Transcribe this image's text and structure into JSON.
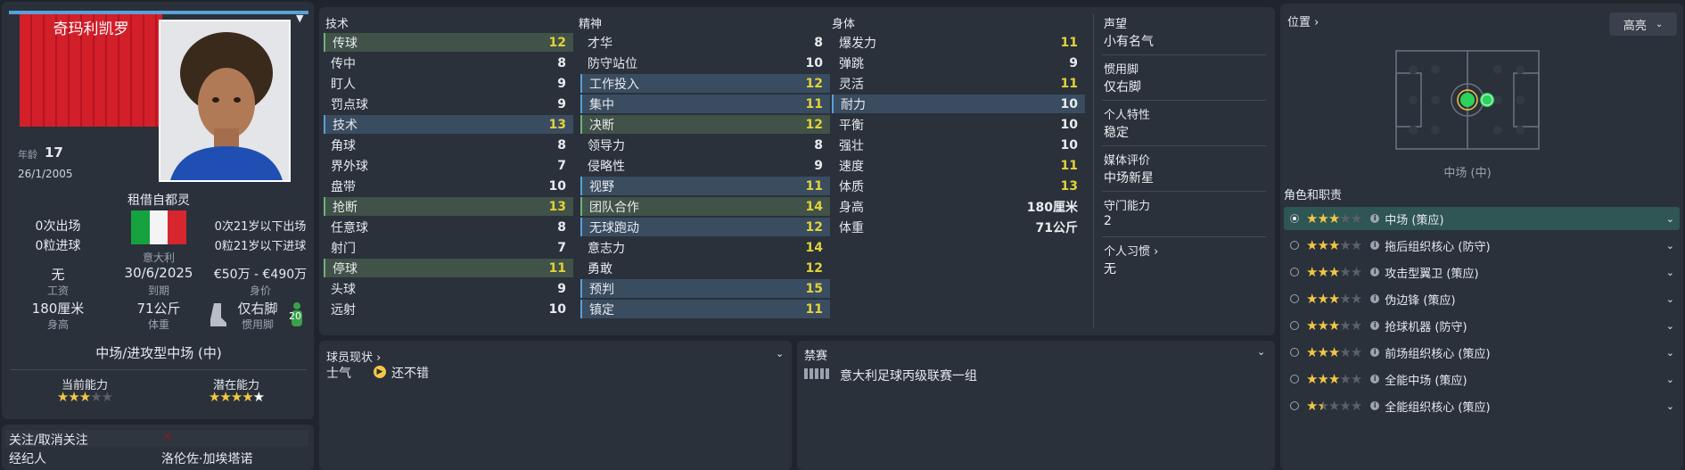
{
  "player": {
    "name": "奇玛利凯罗",
    "age_label": "年龄",
    "age": "17",
    "dob": "26/1/2005",
    "loan_text": "租借自都灵",
    "apps": "0次出场",
    "goals": "0粒进球",
    "u21_apps": "0次21岁以下出场",
    "u21_goals": "0粒21岁以下进球",
    "nation": "意大利",
    "wage_value": "无",
    "wage_label": "工资",
    "expiry_value": "30/6/2025",
    "expiry_label": "到期",
    "value_value": "€50万 - €490万",
    "value_label": "身价",
    "height_value": "180厘米",
    "height_label": "身高",
    "weight_value": "71公斤",
    "weight_label": "体重",
    "foot_value": "仅右脚",
    "foot_label": "惯用脚",
    "foot_badge": "20",
    "position": "中场/进攻型中场 (中)",
    "ca_label": "当前能力",
    "pa_label": "潜在能力",
    "ca_stars": 3,
    "pa_stars": 4.5,
    "follow_label": "关注/取消关注",
    "agent_label": "经纪人",
    "agent_value": "洛伦佐·加埃塔诺"
  },
  "attributes": {
    "technical_title": "技术",
    "mental_title": "精神",
    "physical_title": "身体",
    "technical": [
      {
        "name": "传球",
        "value": "12",
        "hl": "g",
        "y": true
      },
      {
        "name": "传中",
        "value": "8",
        "hl": "",
        "y": false
      },
      {
        "name": "盯人",
        "value": "9",
        "hl": "",
        "y": false
      },
      {
        "name": "罚点球",
        "value": "9",
        "hl": "",
        "y": false
      },
      {
        "name": "技术",
        "value": "13",
        "hl": "b",
        "y": true
      },
      {
        "name": "角球",
        "value": "8",
        "hl": "",
        "y": false
      },
      {
        "name": "界外球",
        "value": "7",
        "hl": "",
        "y": false
      },
      {
        "name": "盘带",
        "value": "10",
        "hl": "",
        "y": false
      },
      {
        "name": "抢断",
        "value": "13",
        "hl": "g",
        "y": true
      },
      {
        "name": "任意球",
        "value": "8",
        "hl": "",
        "y": false
      },
      {
        "name": "射门",
        "value": "7",
        "hl": "",
        "y": false
      },
      {
        "name": "停球",
        "value": "11",
        "hl": "g",
        "y": true
      },
      {
        "name": "头球",
        "value": "9",
        "hl": "",
        "y": false
      },
      {
        "name": "远射",
        "value": "10",
        "hl": "",
        "y": false
      }
    ],
    "mental": [
      {
        "name": "才华",
        "value": "8",
        "hl": "",
        "y": false
      },
      {
        "name": "防守站位",
        "value": "10",
        "hl": "",
        "y": false
      },
      {
        "name": "工作投入",
        "value": "12",
        "hl": "b",
        "y": true
      },
      {
        "name": "集中",
        "value": "11",
        "hl": "b",
        "y": true
      },
      {
        "name": "决断",
        "value": "12",
        "hl": "g",
        "y": true
      },
      {
        "name": "领导力",
        "value": "8",
        "hl": "",
        "y": false
      },
      {
        "name": "侵略性",
        "value": "9",
        "hl": "",
        "y": false
      },
      {
        "name": "视野",
        "value": "11",
        "hl": "b",
        "y": true
      },
      {
        "name": "团队合作",
        "value": "14",
        "hl": "g",
        "y": true
      },
      {
        "name": "无球跑动",
        "value": "12",
        "hl": "b",
        "y": true
      },
      {
        "name": "意志力",
        "value": "14",
        "hl": "",
        "y": true
      },
      {
        "name": "勇敢",
        "value": "12",
        "hl": "",
        "y": true
      },
      {
        "name": "预判",
        "value": "15",
        "hl": "b",
        "y": true
      },
      {
        "name": "镇定",
        "value": "11",
        "hl": "b",
        "y": true
      }
    ],
    "physical": [
      {
        "name": "爆发力",
        "value": "11",
        "hl": "",
        "y": true
      },
      {
        "name": "弹跳",
        "value": "9",
        "hl": "",
        "y": false
      },
      {
        "name": "灵活",
        "value": "11",
        "hl": "",
        "y": true
      },
      {
        "name": "耐力",
        "value": "10",
        "hl": "b",
        "y": false
      },
      {
        "name": "平衡",
        "value": "10",
        "hl": "",
        "y": false
      },
      {
        "name": "强壮",
        "value": "10",
        "hl": "",
        "y": false
      },
      {
        "name": "速度",
        "value": "11",
        "hl": "",
        "y": true
      },
      {
        "name": "体质",
        "value": "13",
        "hl": "",
        "y": true
      },
      {
        "name": "身高",
        "value": "180厘米",
        "hl": "",
        "y": false
      },
      {
        "name": "体重",
        "value": "71公斤",
        "hl": "",
        "y": false
      }
    ]
  },
  "info": [
    {
      "label": "声望",
      "value": "小有名气"
    },
    {
      "label": "惯用脚",
      "value": "仅右脚"
    },
    {
      "label": "个人特性",
      "value": "稳定"
    },
    {
      "label": "媒体评价",
      "value": "中场新星"
    },
    {
      "label": "守门能力",
      "value": "2"
    },
    {
      "label": "个人习惯",
      "value": "无"
    }
  ],
  "status": {
    "title": "球员现状",
    "morale_label": "士气",
    "morale_value": "还不错"
  },
  "ban": {
    "title": "禁赛",
    "competition": "意大利足球丙级联赛一组"
  },
  "right": {
    "position_title": "位置",
    "highlight_btn": "高亮",
    "pitch_caption": "中场 (中)",
    "roles_title": "角色和职责",
    "roles": [
      {
        "name": "中场 (策应)",
        "stars": 3,
        "selected": true
      },
      {
        "name": "拖后组织核心 (防守)",
        "stars": 3,
        "selected": false
      },
      {
        "name": "攻击型翼卫 (策应)",
        "stars": 3,
        "selected": false
      },
      {
        "name": "伪边锋 (策应)",
        "stars": 3,
        "selected": false
      },
      {
        "name": "抢球机器 (防守)",
        "stars": 3,
        "selected": false
      },
      {
        "name": "前场组织核心 (策应)",
        "stars": 3,
        "selected": false
      },
      {
        "name": "全能中场 (策应)",
        "stars": 3,
        "selected": false
      },
      {
        "name": "全能组织核心 (策应)",
        "stars": 1.5,
        "selected": false
      }
    ]
  },
  "colors": {
    "accent_green": "#2bd35a",
    "star": "#f2c744",
    "club_red": "#d31f2a"
  }
}
